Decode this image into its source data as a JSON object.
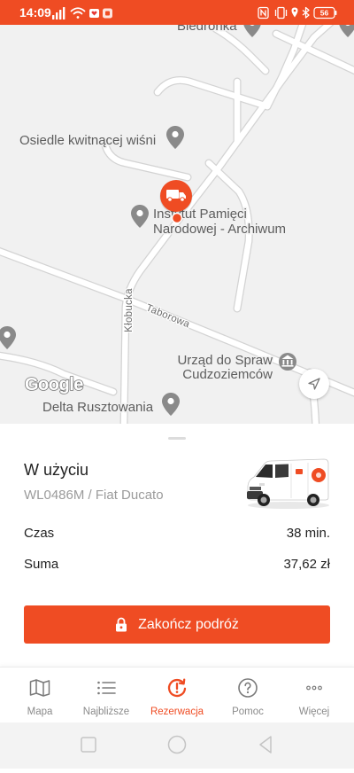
{
  "status_bar": {
    "time": "14:09",
    "battery_level": "56",
    "left_icons": [
      "signal-icon",
      "wifi-icon",
      "notification-icon",
      "app-notification-icon"
    ],
    "right_icons": [
      "nfc-icon",
      "vibrate-icon",
      "location-icon",
      "bluetooth-icon",
      "battery-icon"
    ]
  },
  "map": {
    "places": {
      "biedronka": "Biedronka",
      "osiedle": "Osiedle kwitnącej wiśni",
      "ipn": [
        "Instytut Pamięci",
        "Narodowej - Archiwum"
      ],
      "urzad": [
        "Urząd do Spraw",
        "Cudzoziemców"
      ],
      "delta": "Delta Rusztowania"
    },
    "streets": {
      "klobucka": "Kłobucka",
      "taborowa": "Taborowa"
    },
    "attribution": "Google",
    "vehicle_marker_icon": "van-icon",
    "locate_button_icon": "navigation-arrow-icon"
  },
  "trip": {
    "status": "W użyciu",
    "vehicle": "WL0486M / Fiat Ducato",
    "vehicle_image_icon": "van-image",
    "details": [
      {
        "label": "Czas",
        "value": "38 min."
      },
      {
        "label": "Suma",
        "value": "37,62 zł"
      }
    ],
    "end_button": {
      "label": "Zakończ podróż",
      "icon": "lock-icon"
    }
  },
  "bottom_nav": {
    "items": [
      {
        "label": "Mapa",
        "icon": "map-icon"
      },
      {
        "label": "Najbliższe",
        "icon": "list-icon"
      },
      {
        "label": "Rezerwacja",
        "icon": "reservation-icon",
        "active": true
      },
      {
        "label": "Pomoc",
        "icon": "help-icon"
      },
      {
        "label": "Więcej",
        "icon": "more-icon"
      }
    ]
  },
  "system_nav": {
    "icons": [
      "recents-icon",
      "home-icon",
      "back-icon"
    ]
  },
  "colors": {
    "accent": "#ef4c23",
    "map_background": "#f1f1f1",
    "text_primary": "#222222",
    "text_secondary": "#9b9b9b",
    "nav_inactive": "#8a8a8a"
  }
}
